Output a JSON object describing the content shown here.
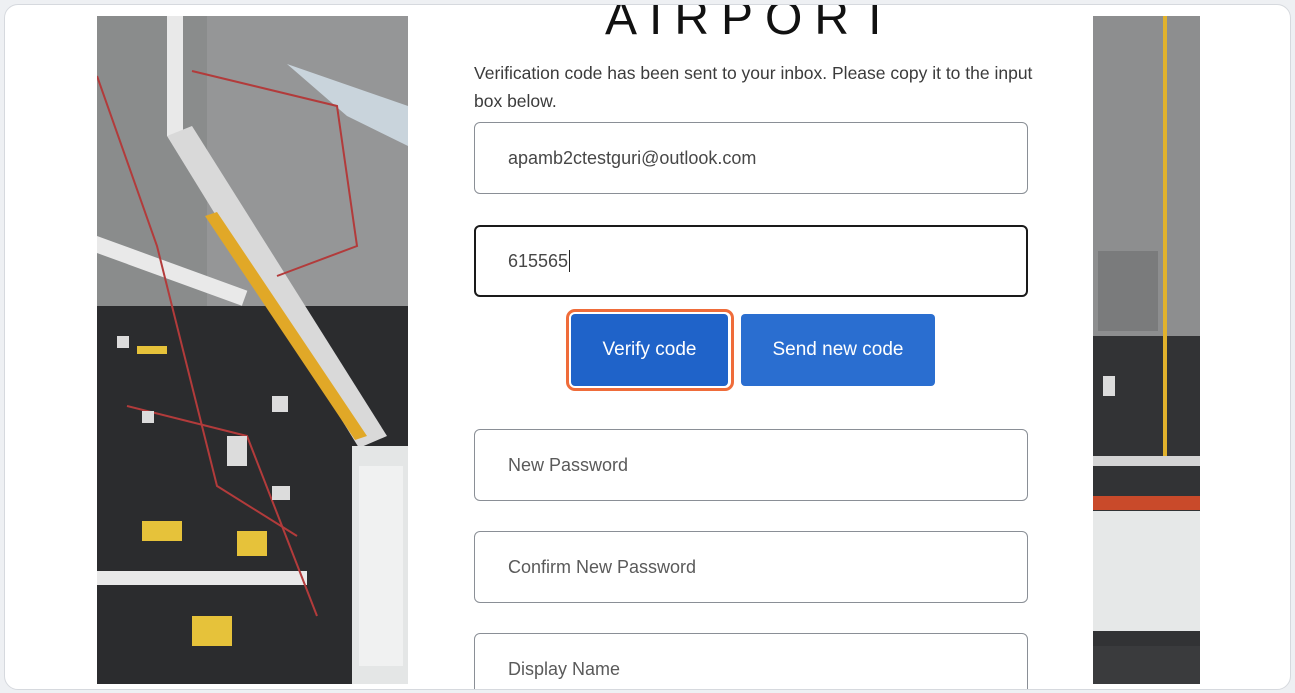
{
  "brand": {
    "wordmark": "AIRPORT"
  },
  "intro": {
    "text": "Verification code has been sent to your inbox. Please copy it to the input box below."
  },
  "fields": {
    "email": {
      "value": "apamb2ctestguri@outlook.com"
    },
    "code": {
      "value": "615565"
    },
    "new_password": {
      "placeholder": "New Password"
    },
    "confirm_password": {
      "placeholder": "Confirm New Password"
    },
    "display_name": {
      "placeholder": "Display Name"
    }
  },
  "buttons": {
    "verify": "Verify code",
    "send_new": "Send new code"
  },
  "colors": {
    "primary_button": "#2a6ed0",
    "highlight_ring": "#ef6c3a",
    "focused_border": "#1a1a1a"
  }
}
